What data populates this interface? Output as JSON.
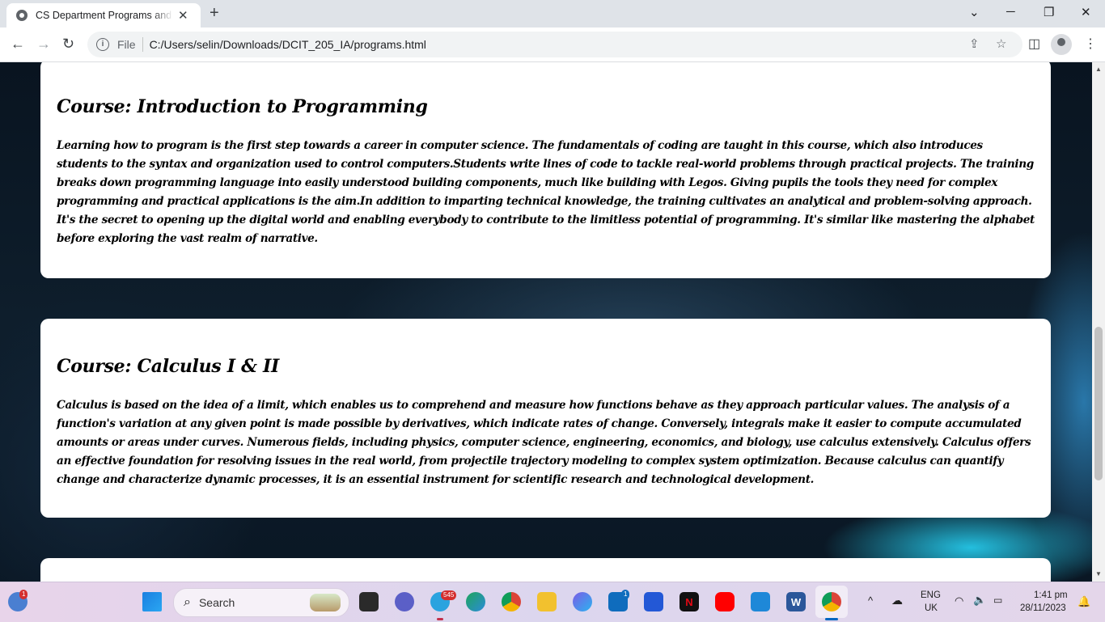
{
  "browser": {
    "tab_title": "CS Department Programs and Courses",
    "tab_close": "✕",
    "new_tab": "+",
    "minimize": "─",
    "maximize": "❐",
    "close": "✕",
    "back": "←",
    "forward": "→",
    "reload": "↻",
    "address": {
      "info": "i",
      "scheme": "File",
      "url": "C:/Users/selin/Downloads/DCIT_205_IA/programs.html"
    },
    "share": "⇪",
    "bookmark": "☆",
    "side_panel": "◫",
    "menu": "⋮",
    "chevron": "⌄"
  },
  "page": {
    "courses": [
      {
        "title": "Course: Introduction to Programming",
        "description": "Learning how to program is the first step towards a career in computer science. The fundamentals of coding are taught in this course, which also introduces students to the syntax and organization used to control computers.Students write lines of code to tackle real-world problems through practical projects. The training breaks down programming language into easily understood building components, much like building with Legos. Giving pupils the tools they need for complex programming and practical applications is the aim.In addition to imparting technical knowledge, the training cultivates an analytical and problem-solving approach. It's the secret to opening up the digital world and enabling everybody to contribute to the limitless potential of programming. It's similar like mastering the alphabet before exploring the vast realm of narrative."
      },
      {
        "title": "Course: Calculus I & II",
        "description": "Calculus is based on the idea of a limit, which enables us to comprehend and measure how functions behave as they approach particular values. The analysis of a function's variation at any given point is made possible by derivatives, which indicate rates of change. Conversely, integrals make it easier to compute accumulated amounts or areas under curves. Numerous fields, including physics, computer science, engineering, economics, and biology, use calculus extensively. Calculus offers an effective foundation for resolving issues in the real world, from projectile trajectory modeling to complex system optimization. Because calculus can quantify change and characterize dynamic processes, it is an essential instrument for scientific research and technological development."
      }
    ]
  },
  "taskbar": {
    "widgets_badge": "1",
    "search_label": "Search",
    "search_icon": "⌕",
    "telegram_badge": "545",
    "mail_badge": "1",
    "language": "ENG",
    "region": "UK",
    "time": "1:41 pm",
    "date": "28/11/2023",
    "tray_chevron": "^",
    "icons": {
      "start": "start-icon",
      "taskview": "task-view-icon",
      "teams": "teams-icon",
      "telegram": "telegram-icon",
      "edge": "edge-icon",
      "chrome": "chrome-icon",
      "explorer": "file-explorer-icon",
      "copilot": "copilot-icon",
      "mail": "mail-icon",
      "power_automate": "power-automate-icon",
      "netflix": "netflix-icon",
      "youtube": "youtube-icon",
      "vscode": "vscode-icon",
      "word": "word-icon",
      "chrome_active": "chrome-icon"
    },
    "netflix_letter": "N",
    "word_letter": "W"
  }
}
